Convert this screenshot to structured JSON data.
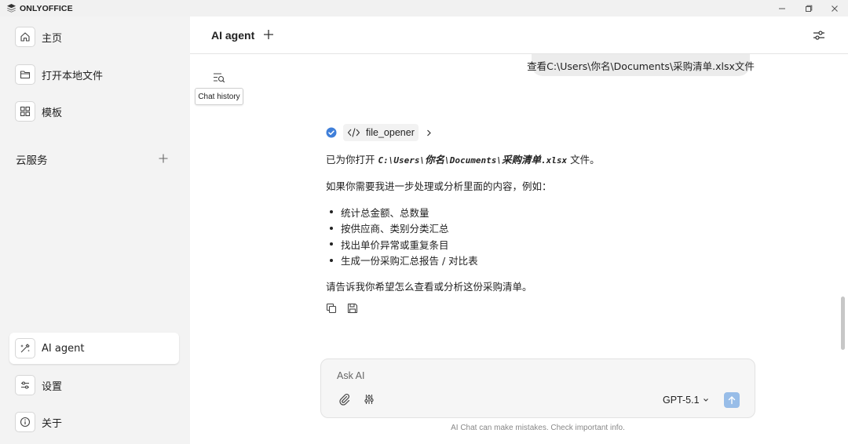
{
  "app": {
    "brand": "ONLYOFFICE",
    "logo_icon": "onlyoffice-logo-icon",
    "window_controls": [
      "minimize-icon",
      "restore-icon",
      "close-icon"
    ]
  },
  "sidebar": {
    "top_items": [
      {
        "label": "主页",
        "icon": "home-icon"
      },
      {
        "label": "打开本地文件",
        "icon": "folder-icon"
      },
      {
        "label": "模板",
        "icon": "grid-icon"
      }
    ],
    "cloud_title": "云服务",
    "bottom_items": [
      {
        "label": "AI agent",
        "icon": "ai-sparkle-icon",
        "active": true
      },
      {
        "label": "设置",
        "icon": "sliders-icon"
      },
      {
        "label": "关于",
        "icon": "info-icon"
      }
    ]
  },
  "header": {
    "title": "AI agent"
  },
  "chat": {
    "history_tooltip": "Chat history",
    "user_message": "查看C:\\Users\\你名\\Documents\\采购清单.xlsx文件",
    "tool": {
      "name": "file_opener",
      "status": "completed"
    },
    "reply": {
      "line1_prefix": "已为你打开 ",
      "path_parts": [
        "C:\\Users\\",
        "你名",
        "\\Documents\\",
        "采购清单",
        ".xlsx"
      ],
      "line1_suffix": " 文件。",
      "line2": "如果你需要我进一步处理或分析里面的内容，例如：",
      "bullets": [
        "统计总金额、总数量",
        "按供应商、类别分类汇总",
        "找出单价异常或重复条目",
        "生成一份采购汇总报告 / 对比表"
      ],
      "line3": "请告诉我你希望怎么查看或分析这份采购清单。"
    }
  },
  "composer": {
    "placeholder": "Ask AI",
    "model": "GPT-5.1",
    "disclaimer": "AI Chat can make mistakes. Check important info."
  },
  "colors": {
    "accent": "#3f7fd9",
    "send_button": "#98bde8",
    "sidebar_bg": "#f3f3f3"
  }
}
